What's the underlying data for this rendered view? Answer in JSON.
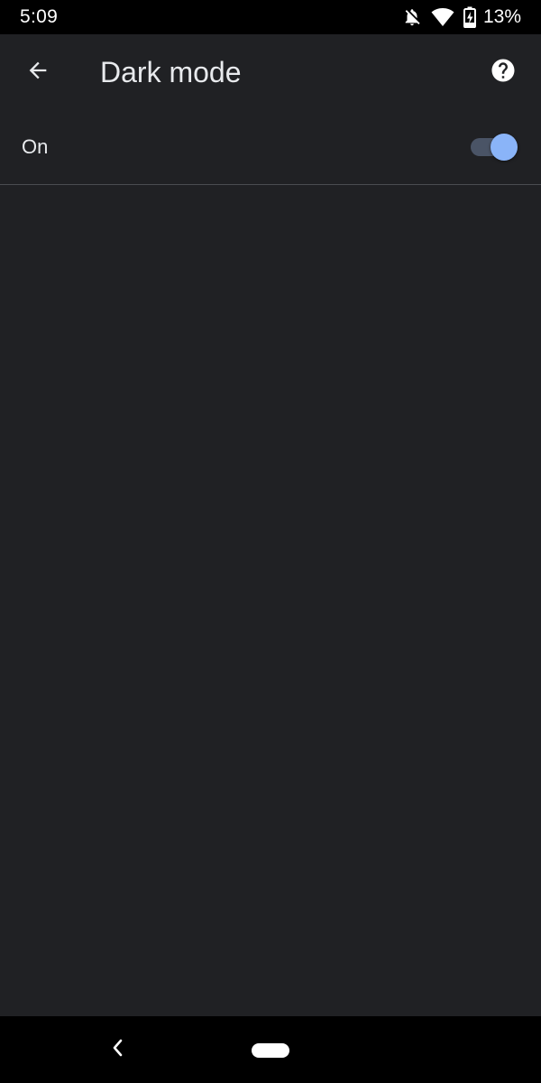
{
  "status_bar": {
    "time": "5:09",
    "battery_percent": "13%",
    "icons": [
      "notifications-off-icon",
      "wifi-icon",
      "battery-charging-icon"
    ]
  },
  "app_bar": {
    "title": "Dark mode",
    "back_icon": "arrow-back-icon",
    "help_icon": "help-icon"
  },
  "settings": {
    "dark_mode": {
      "label": "On",
      "enabled": true
    }
  },
  "nav_bar": {
    "back_icon": "chevron-left-icon",
    "home_icon": "home-pill-icon"
  },
  "colors": {
    "background": "#202124",
    "status_bar": "#000000",
    "text_primary": "#e8eaed",
    "toggle_thumb": "#8ab4f8",
    "toggle_track": "#4a5466",
    "divider": "#4a4c50"
  }
}
